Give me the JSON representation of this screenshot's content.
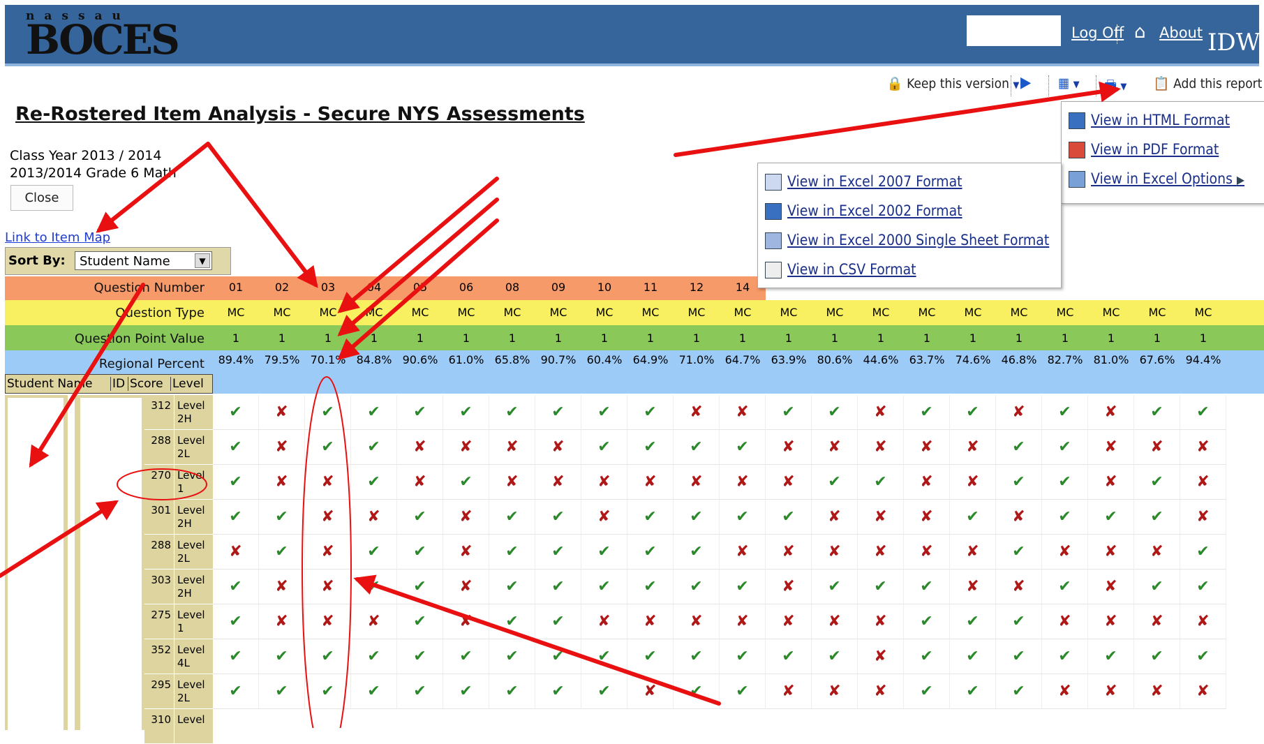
{
  "banner": {
    "logo_top": "nassau",
    "logo": "BOCES",
    "logoff": "Log Off",
    "about": "About",
    "idw": "IDW",
    "home_icon": "house-icon"
  },
  "toolbar": {
    "keep_version": "Keep this version",
    "add_report": "Add this report"
  },
  "page": {
    "title": "Re-Rostered Item Analysis - Secure NYS Assessments",
    "class_year": "Class Year 2013 / 2014",
    "grade": "2013/2014 Grade 6 Math",
    "close": "Close",
    "item_map_link": "Link to Item Map"
  },
  "sort": {
    "label": "Sort By:",
    "value": "Student Name"
  },
  "row_labels": {
    "question_number": "Question Number",
    "question_type": "Question Type",
    "point_value": "Question Point Value",
    "regional_percent": "Regional Percent"
  },
  "student_headers": {
    "name": "Student Name",
    "id": "ID",
    "score": "Score",
    "level": "Level"
  },
  "columns": [
    {
      "num": "01",
      "type": "MC",
      "points": "1",
      "pct": "89.4%"
    },
    {
      "num": "02",
      "type": "MC",
      "points": "1",
      "pct": "79.5%"
    },
    {
      "num": "03",
      "type": "MC",
      "points": "1",
      "pct": "70.1%"
    },
    {
      "num": "04",
      "type": "MC",
      "points": "1",
      "pct": "84.8%"
    },
    {
      "num": "05",
      "type": "MC",
      "points": "1",
      "pct": "90.6%"
    },
    {
      "num": "06",
      "type": "MC",
      "points": "1",
      "pct": "61.0%"
    },
    {
      "num": "08",
      "type": "MC",
      "points": "1",
      "pct": "65.8%"
    },
    {
      "num": "09",
      "type": "MC",
      "points": "1",
      "pct": "90.7%"
    },
    {
      "num": "10",
      "type": "MC",
      "points": "1",
      "pct": "60.4%"
    },
    {
      "num": "11",
      "type": "MC",
      "points": "1",
      "pct": "64.9%"
    },
    {
      "num": "12",
      "type": "MC",
      "points": "1",
      "pct": "71.0%"
    },
    {
      "num": "14",
      "type": "MC",
      "points": "1",
      "pct": "64.7%"
    },
    {
      "num": "",
      "type": "MC",
      "points": "1",
      "pct": "63.9%"
    },
    {
      "num": "",
      "type": "MC",
      "points": "1",
      "pct": "80.6%"
    },
    {
      "num": "",
      "type": "MC",
      "points": "1",
      "pct": "44.6%"
    },
    {
      "num": "",
      "type": "MC",
      "points": "1",
      "pct": "63.7%"
    },
    {
      "num": "",
      "type": "MC",
      "points": "1",
      "pct": "74.6%"
    },
    {
      "num": "",
      "type": "MC",
      "points": "1",
      "pct": "46.8%"
    },
    {
      "num": "",
      "type": "MC",
      "points": "1",
      "pct": "82.7%"
    },
    {
      "num": "",
      "type": "MC",
      "points": "1",
      "pct": "81.0%"
    },
    {
      "num": "",
      "type": "MC",
      "points": "1",
      "pct": "67.6%"
    },
    {
      "num": "",
      "type": "MC",
      "points": "1",
      "pct": "94.4%"
    }
  ],
  "students": [
    {
      "score": "312",
      "level": "Level 2H",
      "results": "1011111111001101101011"
    },
    {
      "score": "288",
      "level": "Level 2L",
      "results": "1011000011110000011000"
    },
    {
      "score": "270",
      "level": "Level 1",
      "results": "1001010000000110011010"
    },
    {
      "score": "301",
      "level": "Level 2H",
      "results": "1100101101111000101110"
    },
    {
      "score": "288",
      "level": "Level 2L",
      "results": "0101101111100000010001"
    },
    {
      "score": "303",
      "level": "Level 2H",
      "results": "1001101111110111001011"
    },
    {
      "score": "275",
      "level": "Level 1",
      "results": "1000101100000001110000"
    },
    {
      "score": "352",
      "level": "Level 4L",
      "results": "1111111111111101111111"
    },
    {
      "score": "295",
      "level": "Level 2L",
      "results": "1111111110110001110000"
    },
    {
      "score": "310",
      "level": "Level"
    }
  ],
  "export_menu": {
    "html": "View in HTML Format",
    "pdf": "View in PDF Format",
    "excel_options": "View in Excel Options"
  },
  "excel_submenu": {
    "e2007": "View in Excel 2007 Format",
    "e2002": "View in Excel 2002 Format",
    "e2000": "View in Excel 2000 Single Sheet Format",
    "csv": "View in CSV Format"
  }
}
